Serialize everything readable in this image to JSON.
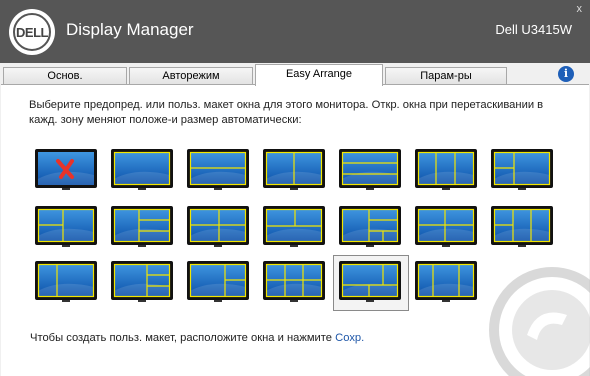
{
  "app": {
    "logo_text": "DELL",
    "title": "Display Manager",
    "model": "Dell U3415W",
    "close_glyph": "x"
  },
  "tabs": [
    {
      "label": "Основ.",
      "active": false
    },
    {
      "label": "Авторежим",
      "active": false
    },
    {
      "label": "Easy Arrange",
      "active": true
    },
    {
      "label": "Парам-ры",
      "active": false
    }
  ],
  "info_icon": {
    "glyph": "i",
    "icon": "info-icon",
    "color": "#1e5fb8"
  },
  "description": "Выберите предопред. или польз. макет окна для этого монитора. Откр. окна при перетаскивании в кажд. зону меняют положе-и размер автоматически:",
  "footer": {
    "text": "Чтобы создать польз. макет, расположите окна и нажмите ",
    "link": "Сохр."
  },
  "colors": {
    "zone_line": "#f2e600",
    "screen_top": "#3f96e0",
    "screen_bottom": "#0b4fa8",
    "bezel": "#111111",
    "no_layout_mark": "#e8332a"
  },
  "presets": [
    {
      "id": "none",
      "selected": false
    },
    {
      "id": "full",
      "selected": false
    },
    {
      "id": "rows-2",
      "selected": false
    },
    {
      "id": "cols-2",
      "selected": false
    },
    {
      "id": "rows-3",
      "selected": false
    },
    {
      "id": "cols-3",
      "selected": false
    },
    {
      "id": "left-2-stack-right",
      "selected": false
    },
    {
      "id": "left-big-3-right",
      "selected": false
    },
    {
      "id": "left-big-right-3",
      "selected": false
    },
    {
      "id": "grid-2x2-centre",
      "selected": false
    },
    {
      "id": "top-left-and-bottom",
      "selected": false
    },
    {
      "id": "left-right-4",
      "selected": false
    },
    {
      "id": "left-split-right",
      "selected": false
    },
    {
      "id": "cols-3-left-split",
      "selected": false
    },
    {
      "id": "left-wide-right",
      "selected": false
    },
    {
      "id": "left-wide-right-3",
      "selected": false
    },
    {
      "id": "left-wide-right-2",
      "selected": false
    },
    {
      "id": "grid-2x3",
      "selected": false
    },
    {
      "id": "main-right-bottom",
      "selected": true
    },
    {
      "id": "cols-3-wide-middle",
      "selected": false
    }
  ]
}
